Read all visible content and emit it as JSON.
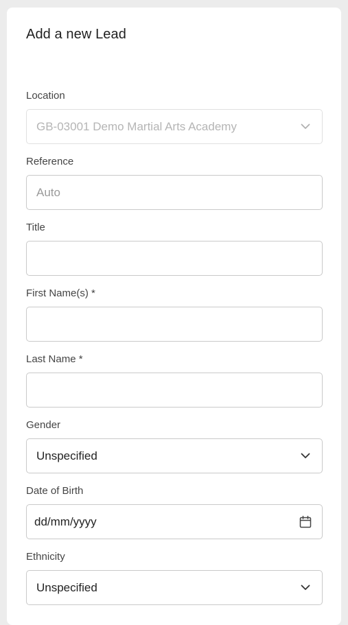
{
  "form": {
    "title": "Add a new Lead",
    "location": {
      "label": "Location",
      "value": "GB-03001 Demo Martial Arts Academy"
    },
    "reference": {
      "label": "Reference",
      "placeholder": "Auto"
    },
    "title_field": {
      "label": "Title",
      "value": ""
    },
    "first_name": {
      "label": "First Name(s) *",
      "value": ""
    },
    "last_name": {
      "label": "Last Name *",
      "value": ""
    },
    "gender": {
      "label": "Gender",
      "value": "Unspecified"
    },
    "dob": {
      "label": "Date of Birth",
      "placeholder": "dd/mm/yyyy"
    },
    "ethnicity": {
      "label": "Ethnicity",
      "value": "Unspecified"
    }
  },
  "icons": {
    "dropdown": "chevron-down-icon",
    "date": "calendar-icon"
  },
  "colors": {
    "background": "#ececec",
    "card": "#ffffff",
    "border": "#c9c9c9",
    "label": "#444444",
    "muted_text": "#b5b5b5"
  }
}
